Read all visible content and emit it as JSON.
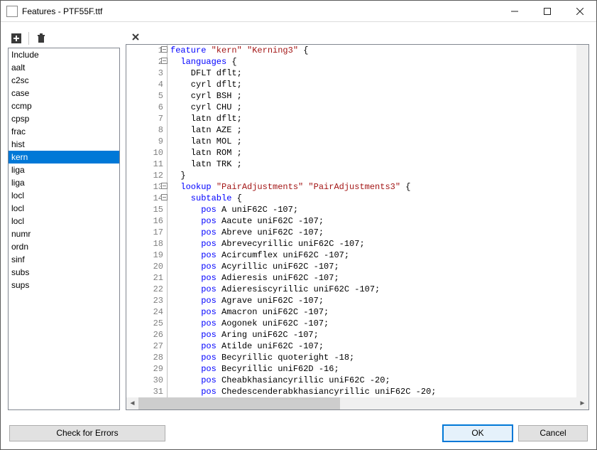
{
  "window": {
    "title": "Features - PTF55F.ttf"
  },
  "toolbar_left": {
    "add_icon": "add",
    "delete_icon": "delete"
  },
  "toolbar_right": {
    "toggle_icon": "arrows"
  },
  "features": [
    {
      "label": "Include",
      "selected": false
    },
    {
      "label": "aalt",
      "selected": false
    },
    {
      "label": "c2sc",
      "selected": false
    },
    {
      "label": "case",
      "selected": false
    },
    {
      "label": "ccmp",
      "selected": false
    },
    {
      "label": "cpsp",
      "selected": false
    },
    {
      "label": "frac",
      "selected": false
    },
    {
      "label": "hist",
      "selected": false
    },
    {
      "label": "kern",
      "selected": true
    },
    {
      "label": "liga",
      "selected": false
    },
    {
      "label": "liga",
      "selected": false
    },
    {
      "label": "locl",
      "selected": false
    },
    {
      "label": "locl",
      "selected": false
    },
    {
      "label": "locl",
      "selected": false
    },
    {
      "label": "numr",
      "selected": false
    },
    {
      "label": "ordn",
      "selected": false
    },
    {
      "label": "sinf",
      "selected": false
    },
    {
      "label": "subs",
      "selected": false
    },
    {
      "label": "sups",
      "selected": false
    }
  ],
  "code": {
    "lines": [
      {
        "n": 1,
        "fold": true,
        "tokens": [
          [
            "feature ",
            "blue"
          ],
          [
            "\"kern\" \"Kerning3\"",
            "red"
          ],
          [
            " {",
            ""
          ]
        ]
      },
      {
        "n": 2,
        "fold": true,
        "tokens": [
          [
            "  languages ",
            "blue"
          ],
          [
            "{",
            ""
          ]
        ]
      },
      {
        "n": 3,
        "fold": false,
        "tokens": [
          [
            "    DFLT dflt;",
            ""
          ]
        ]
      },
      {
        "n": 4,
        "fold": false,
        "tokens": [
          [
            "    cyrl dflt;",
            ""
          ]
        ]
      },
      {
        "n": 5,
        "fold": false,
        "tokens": [
          [
            "    cyrl BSH ;",
            ""
          ]
        ]
      },
      {
        "n": 6,
        "fold": false,
        "tokens": [
          [
            "    cyrl CHU ;",
            ""
          ]
        ]
      },
      {
        "n": 7,
        "fold": false,
        "tokens": [
          [
            "    latn dflt;",
            ""
          ]
        ]
      },
      {
        "n": 8,
        "fold": false,
        "tokens": [
          [
            "    latn AZE ;",
            ""
          ]
        ]
      },
      {
        "n": 9,
        "fold": false,
        "tokens": [
          [
            "    latn MOL ;",
            ""
          ]
        ]
      },
      {
        "n": 10,
        "fold": false,
        "tokens": [
          [
            "    latn ROM ;",
            ""
          ]
        ]
      },
      {
        "n": 11,
        "fold": false,
        "tokens": [
          [
            "    latn TRK ;",
            ""
          ]
        ]
      },
      {
        "n": 12,
        "fold": false,
        "tokens": [
          [
            "  }",
            ""
          ]
        ]
      },
      {
        "n": 13,
        "fold": true,
        "tokens": [
          [
            "  lookup ",
            "blue"
          ],
          [
            "\"PairAdjustments\" \"PairAdjustments3\"",
            "red"
          ],
          [
            " {",
            ""
          ]
        ]
      },
      {
        "n": 14,
        "fold": true,
        "tokens": [
          [
            "    subtable ",
            "blue"
          ],
          [
            "{",
            ""
          ]
        ]
      },
      {
        "n": 15,
        "fold": false,
        "tokens": [
          [
            "      pos ",
            "blue"
          ],
          [
            "A uniF62C -107;",
            ""
          ]
        ]
      },
      {
        "n": 16,
        "fold": false,
        "tokens": [
          [
            "      pos ",
            "blue"
          ],
          [
            "Aacute uniF62C -107;",
            ""
          ]
        ]
      },
      {
        "n": 17,
        "fold": false,
        "tokens": [
          [
            "      pos ",
            "blue"
          ],
          [
            "Abreve uniF62C -107;",
            ""
          ]
        ]
      },
      {
        "n": 18,
        "fold": false,
        "tokens": [
          [
            "      pos ",
            "blue"
          ],
          [
            "Abrevecyrillic uniF62C -107;",
            ""
          ]
        ]
      },
      {
        "n": 19,
        "fold": false,
        "tokens": [
          [
            "      pos ",
            "blue"
          ],
          [
            "Acircumflex uniF62C -107;",
            ""
          ]
        ]
      },
      {
        "n": 20,
        "fold": false,
        "tokens": [
          [
            "      pos ",
            "blue"
          ],
          [
            "Acyrillic uniF62C -107;",
            ""
          ]
        ]
      },
      {
        "n": 21,
        "fold": false,
        "tokens": [
          [
            "      pos ",
            "blue"
          ],
          [
            "Adieresis uniF62C -107;",
            ""
          ]
        ]
      },
      {
        "n": 22,
        "fold": false,
        "tokens": [
          [
            "      pos ",
            "blue"
          ],
          [
            "Adieresiscyrillic uniF62C -107;",
            ""
          ]
        ]
      },
      {
        "n": 23,
        "fold": false,
        "tokens": [
          [
            "      pos ",
            "blue"
          ],
          [
            "Agrave uniF62C -107;",
            ""
          ]
        ]
      },
      {
        "n": 24,
        "fold": false,
        "tokens": [
          [
            "      pos ",
            "blue"
          ],
          [
            "Amacron uniF62C -107;",
            ""
          ]
        ]
      },
      {
        "n": 25,
        "fold": false,
        "tokens": [
          [
            "      pos ",
            "blue"
          ],
          [
            "Aogonek uniF62C -107;",
            ""
          ]
        ]
      },
      {
        "n": 26,
        "fold": false,
        "tokens": [
          [
            "      pos ",
            "blue"
          ],
          [
            "Aring uniF62C -107;",
            ""
          ]
        ]
      },
      {
        "n": 27,
        "fold": false,
        "tokens": [
          [
            "      pos ",
            "blue"
          ],
          [
            "Atilde uniF62C -107;",
            ""
          ]
        ]
      },
      {
        "n": 28,
        "fold": false,
        "tokens": [
          [
            "      pos ",
            "blue"
          ],
          [
            "Becyrillic quoteright -18;",
            ""
          ]
        ]
      },
      {
        "n": 29,
        "fold": false,
        "tokens": [
          [
            "      pos ",
            "blue"
          ],
          [
            "Becyrillic uniF62D -16;",
            ""
          ]
        ]
      },
      {
        "n": 30,
        "fold": false,
        "tokens": [
          [
            "      pos ",
            "blue"
          ],
          [
            "Cheabkhasiancyrillic uniF62C -20;",
            ""
          ]
        ]
      },
      {
        "n": 31,
        "fold": false,
        "tokens": [
          [
            "      pos ",
            "blue"
          ],
          [
            "Chedescenderabkhasiancyrillic uniF62C -20;",
            ""
          ]
        ]
      }
    ]
  },
  "buttons": {
    "check": "Check for Errors",
    "ok": "OK",
    "cancel": "Cancel"
  }
}
